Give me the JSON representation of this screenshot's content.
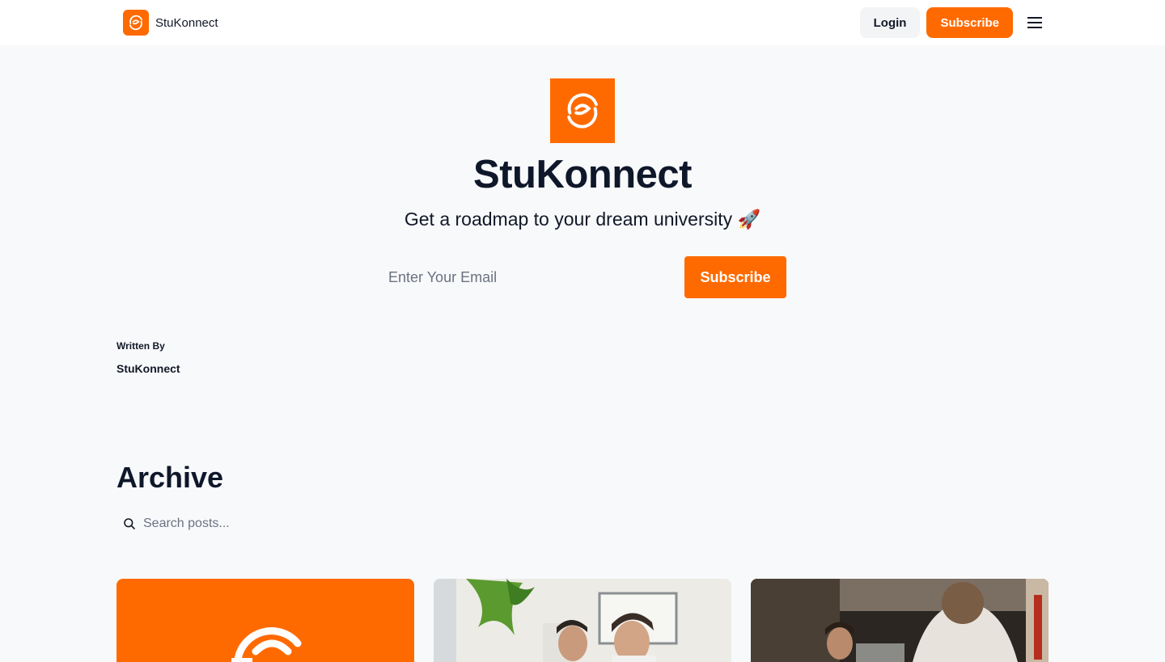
{
  "nav": {
    "brand_name": "StuKonnect",
    "login_label": "Login",
    "subscribe_label": "Subscribe",
    "menu_icon": "hamburger-menu-icon"
  },
  "hero": {
    "title": "StuKonnect",
    "tagline": "Get a roadmap to your dream university 🚀",
    "email_placeholder": "Enter Your Email",
    "subscribe_label": "Subscribe"
  },
  "author": {
    "heading": "Written By",
    "name": "StuKonnect"
  },
  "archive": {
    "title": "Archive",
    "search_placeholder": "Search posts..."
  },
  "colors": {
    "brand": "#ff6a00",
    "background": "#f8f9fb",
    "text": "#0f172a"
  }
}
